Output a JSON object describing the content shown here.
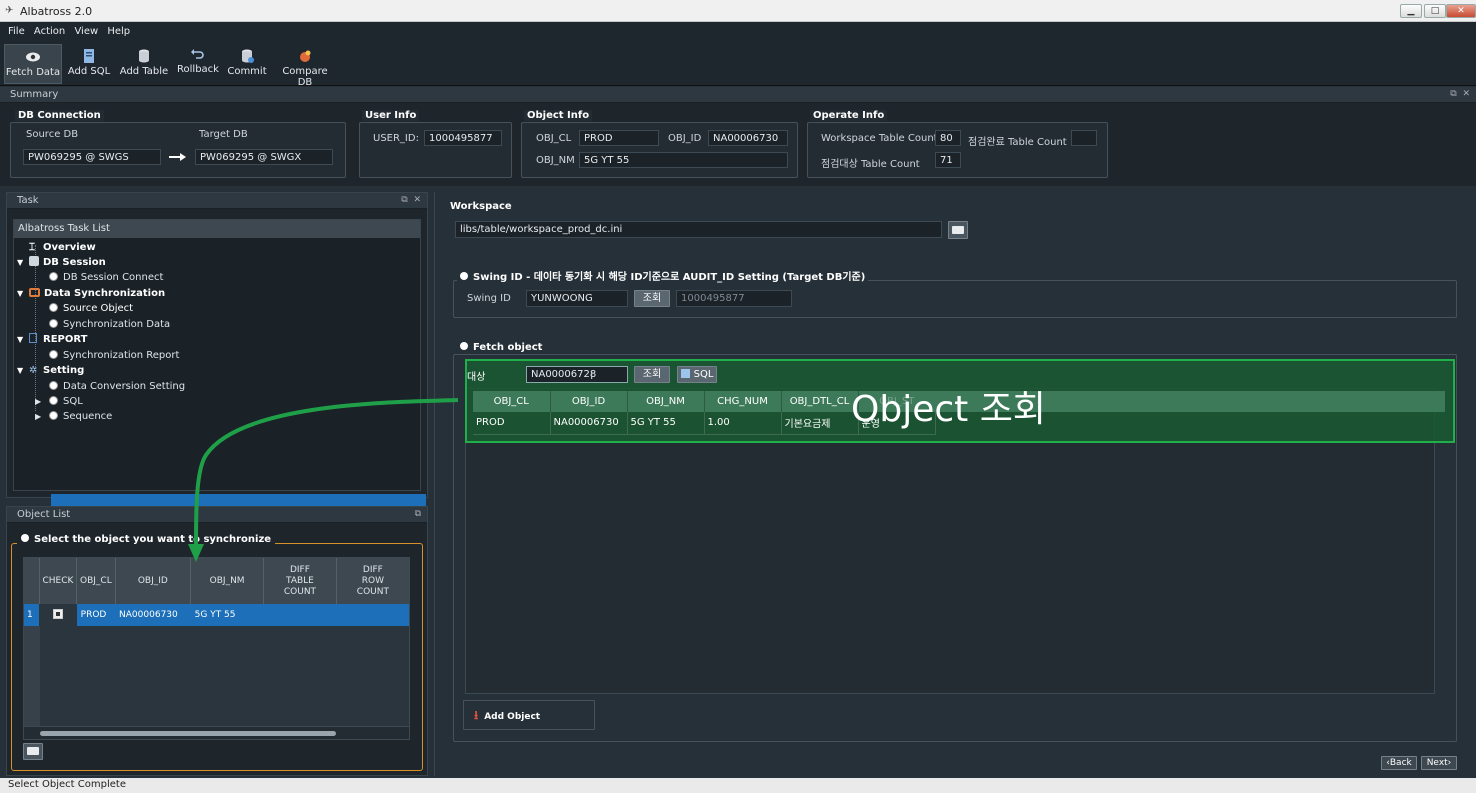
{
  "window": {
    "title": "Albatross 2.0"
  },
  "menu": [
    "File",
    "Action",
    "View",
    "Help"
  ],
  "toolbar": [
    {
      "label": "Fetch Data",
      "icon": "eye-icon",
      "color": "#dfe5ea"
    },
    {
      "label": "Add SQL",
      "icon": "sql-doc-icon",
      "color": "#7aa6d6"
    },
    {
      "label": "Add Table",
      "icon": "database-icon",
      "color": "#cfd6dc"
    },
    {
      "label": "Rollback",
      "icon": "undo-icon",
      "color": "#9bb6d8"
    },
    {
      "label": "Commit",
      "icon": "database-commit-icon",
      "color": "#cfd6dc"
    },
    {
      "label": "Compare DB",
      "icon": "compare-db-icon",
      "color": "#e06a3a"
    }
  ],
  "summary": {
    "header": "Summary",
    "db": {
      "title": "DB Connection",
      "source_label": "Source DB",
      "target_label": "Target DB",
      "source": "PW069295 @ SWGS",
      "target": "PW069295 @ SWGX"
    },
    "user": {
      "title": "User Info",
      "id_label": "USER_ID:",
      "id": "1000495877"
    },
    "object": {
      "title": "Object Info",
      "cl_label": "OBJ_CL",
      "cl": "PROD",
      "id_label": "OBJ_ID",
      "id": "NA00006730",
      "nm_label": "OBJ_NM",
      "nm": "5G YT 55"
    },
    "operate": {
      "title": "Operate Info",
      "ws_label": "Workspace Table Count",
      "ws": "80",
      "done_label": "점검완료 Table Count",
      "done": "",
      "target_label": "점검대상 Table Count",
      "target": "71"
    }
  },
  "task": {
    "header": "Task",
    "list_title": "Albatross Task List",
    "items": [
      {
        "label": "Overview",
        "level": 0,
        "bold": true,
        "icon": "overview-icon"
      },
      {
        "label": "DB Session",
        "level": 0,
        "bold": true,
        "icon": "db-session-icon"
      },
      {
        "label": "DB Session Connect",
        "level": 1
      },
      {
        "label": "Data Synchronization",
        "level": 0,
        "bold": true,
        "icon": "sync-icon"
      },
      {
        "label": "Source Object",
        "level": 1,
        "selected": true
      },
      {
        "label": "Synchronization Data",
        "level": 1
      },
      {
        "label": "REPORT",
        "level": 0,
        "bold": true,
        "icon": "report-icon"
      },
      {
        "label": "Synchronization Report",
        "level": 1
      },
      {
        "label": "Setting",
        "level": 0,
        "bold": true,
        "icon": "gear-icon"
      },
      {
        "label": "Data Conversion Setting",
        "level": 1
      },
      {
        "label": "SQL",
        "level": 1
      },
      {
        "label": "Sequence",
        "level": 1
      }
    ]
  },
  "object_list": {
    "header": "Object List",
    "title": "Select the object you want to synchronize",
    "columns": [
      "CHECK",
      "OBJ_CL",
      "OBJ_ID",
      "OBJ_NM",
      "DIFF\nTABLE\nCOUNT",
      "DIFF\nROW\nCOUNT"
    ],
    "rows": [
      {
        "num": "1",
        "check": "■",
        "cl": "PROD",
        "id": "NA00006730",
        "nm": "5G YT 55",
        "dtc": "",
        "drc": ""
      }
    ]
  },
  "workspace": {
    "title": "Workspace",
    "path": "libs/table/workspace_prod_dc.ini",
    "swing": {
      "title": "Swing ID - 데이타 동기화 시 해당 ID기준으로 AUDIT_ID Setting (Target DB기준)",
      "label": "Swing ID",
      "value": "YUNWOONG",
      "button": "조회",
      "result": "1000495877"
    },
    "fetch": {
      "title": "Fetch object",
      "label": "대상",
      "value": "NA00006728",
      "button": "조회",
      "sql_button": "SQL",
      "columns": [
        "OBJ_CL",
        "OBJ_ID",
        "OBJ_NM",
        "CHG_NUM",
        "OBJ_DTL_CL",
        "OBJ_ST"
      ],
      "rows": [
        [
          "PROD",
          "NA00006730",
          "5G YT 55",
          "1.00",
          "기본요금제",
          "운영"
        ]
      ],
      "add_button": "Add Object"
    },
    "annotation": "Object 조회",
    "back": "Back",
    "next": "Next"
  },
  "status": "Select Object Complete",
  "colors": {
    "accent_green": "#1fb04a",
    "selection_blue": "#1c6fb8",
    "highlight_orange": "#d8902a"
  }
}
